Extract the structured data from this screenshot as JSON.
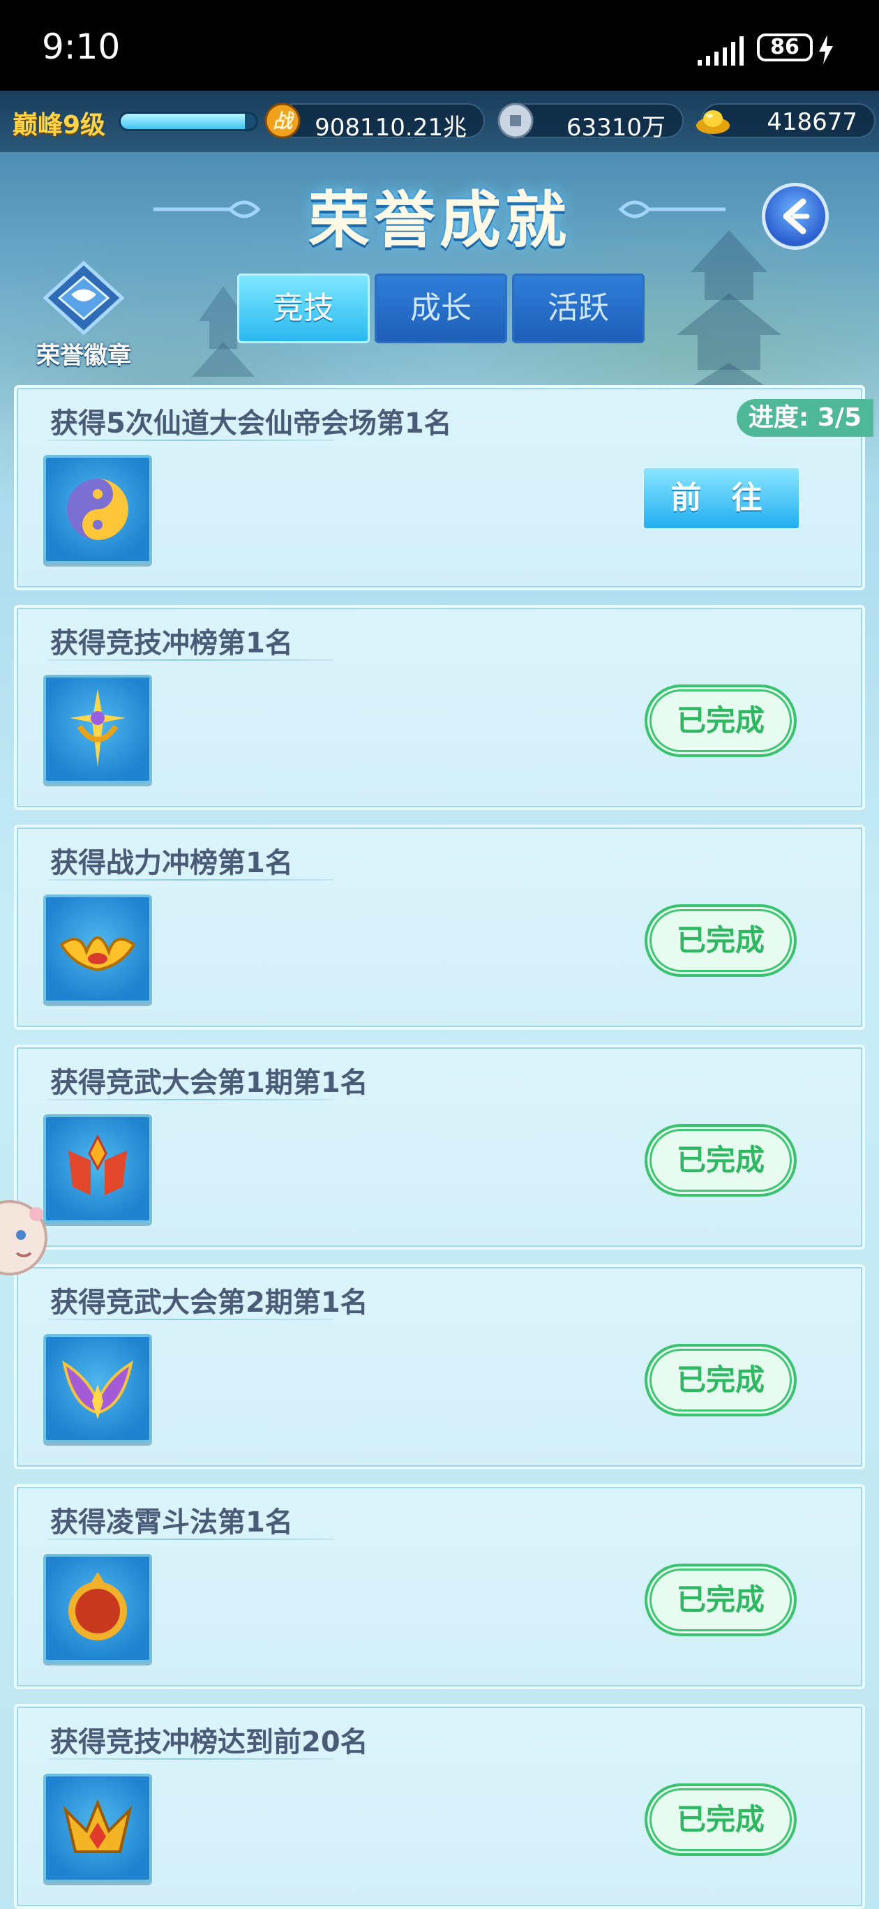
{
  "status_bar": {
    "time": "9:10",
    "battery": "86"
  },
  "resources": {
    "level": "巅峰9级",
    "xp_fraction": 0.92,
    "power_icon_text": "战",
    "power": "908110.21兆",
    "coins": "63310万",
    "gold": "418677"
  },
  "header": {
    "title": "荣誉成就",
    "badge_label": "荣誉徽章"
  },
  "tabs": [
    {
      "label": "竞技",
      "active": true
    },
    {
      "label": "成长",
      "active": false
    },
    {
      "label": "活跃",
      "active": false
    }
  ],
  "achievements": [
    {
      "title": "获得5次仙道大会仙帝会场第1名",
      "icon": "yin-yang-orb-icon",
      "progress": "进度: 3/5",
      "action": "前 往",
      "state": "go"
    },
    {
      "title": "获得竞技冲榜第1名",
      "icon": "star-trident-icon",
      "action": "已完成",
      "state": "done"
    },
    {
      "title": "获得战力冲榜第1名",
      "icon": "golden-crown-icon",
      "action": "已完成",
      "state": "done"
    },
    {
      "title": "获得竞武大会第1期第1名",
      "icon": "red-banner-crest-icon",
      "action": "已完成",
      "state": "done"
    },
    {
      "title": "获得竞武大会第2期第1名",
      "icon": "winged-crest-icon",
      "action": "已完成",
      "state": "done"
    },
    {
      "title": "获得凌霄斗法第1名",
      "icon": "red-shield-emblem-icon",
      "action": "已完成",
      "state": "done"
    },
    {
      "title": "获得竞技冲榜达到前20名",
      "icon": "gold-gem-crown-icon",
      "action": "已完成",
      "state": "done"
    }
  ],
  "colors": {
    "done_green": "#2fb861",
    "progress_tag": "#4fb896",
    "tab_active": "#2ab8ef"
  }
}
